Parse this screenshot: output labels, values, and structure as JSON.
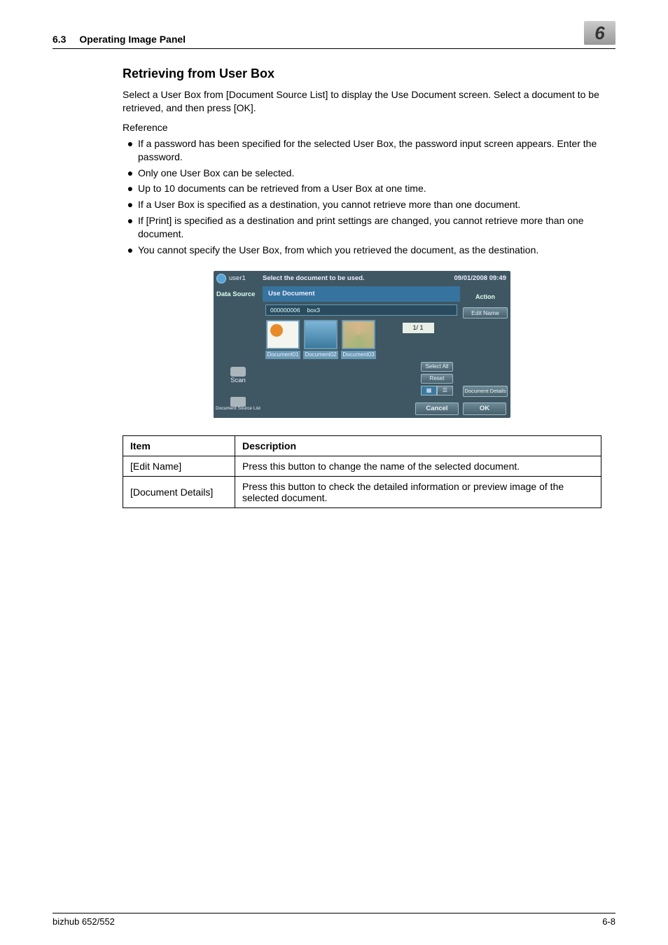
{
  "header": {
    "section_number": "6.3",
    "section_title": "Operating Image Panel",
    "chapter_number": "6"
  },
  "heading": "Retrieving from User Box",
  "intro": "Select a User Box from [Document Source List] to display the Use Document screen. Select a document to be retrieved, and then press [OK].",
  "reference_label": "Reference",
  "bullets": [
    "If a password has been specified for the selected User Box, the password input screen appears. Enter the password.",
    "Only one User Box can be selected.",
    "Up to 10 documents can be retrieved from a User Box at one time.",
    "If a User Box is specified as a destination, you cannot retrieve more than one document.",
    "If [Print] is specified as a destination and print settings are changed, you cannot retrieve more than one document.",
    "You cannot specify the User Box, from which you retrieved the document, as the destination."
  ],
  "shot": {
    "user": "user1",
    "message": "Select the document to be used.",
    "datetime": "09/01/2008 09:49",
    "data_source": "Data Source",
    "scan_label": "Scan",
    "dsl_label": "Document Source List",
    "use_document": "Use Document",
    "box_id": "000000006",
    "box_name": "box3",
    "docs": [
      "Document01",
      "Document02",
      "Document03"
    ],
    "pager": "1/  1",
    "action_label": "Action",
    "edit_name": "Edit Name",
    "select_all": "Select All",
    "reset": "Reset",
    "doc_details": "Document Details",
    "cancel": "Cancel",
    "ok": "OK"
  },
  "table": {
    "head": {
      "item": "Item",
      "desc": "Description"
    },
    "rows": [
      {
        "item": "[Edit Name]",
        "desc": "Press this button to change the name of the selected document."
      },
      {
        "item": "[Document Details]",
        "desc": "Press this button to check the detailed information or preview image of the selected document."
      }
    ]
  },
  "footer": {
    "product": "bizhub 652/552",
    "page": "6-8"
  }
}
